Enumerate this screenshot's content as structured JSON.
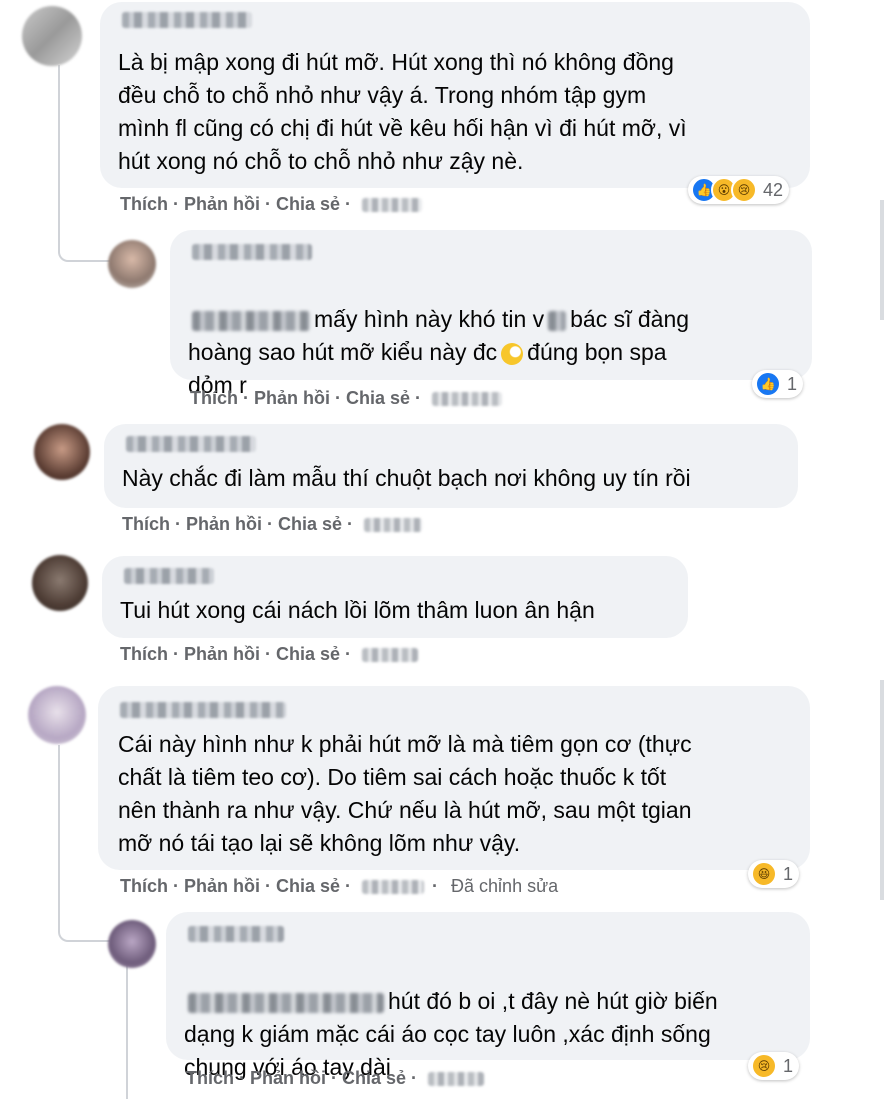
{
  "actions": {
    "like": "Thích",
    "reply": "Phản hồi",
    "share": "Chia sẻ",
    "sep": "·"
  },
  "comments": [
    {
      "text": "Là bị mập xong đi hút mỡ. Hút xong thì nó không đồng\nđều chỗ to chỗ nhỏ như vậy á. Trong nhóm tập gym\nmình fl cũng có chị đi hút về kêu hối hận vì đi hút mỡ, vì\nhút xong nó chỗ to chỗ nhỏ như zậy nè.",
      "reactions": {
        "icons": [
          "like-icon",
          "wow-icon",
          "sad-icon"
        ],
        "count": "42"
      }
    },
    {
      "text_a": "mấy hình này khó tin v",
      "text_b": "bác sĩ đàng",
      "text_c": "hoàng sao hút mỡ kiểu này đc",
      "text_d": "đúng bọn spa\ndỏm r",
      "reactions": {
        "icons": [
          "like-icon"
        ],
        "count": "1"
      }
    },
    {
      "text": "Này chắc đi làm mẫu thí chuột bạch nơi không uy tín rồi"
    },
    {
      "text": "Tui hút xong cái nách lồi lõm thâm luon ân hận"
    },
    {
      "text": "Cái này hình như k phải hút mỡ là mà tiêm gọn cơ (thực\nchất là tiêm teo cơ). Do tiêm sai cách hoặc thuốc k tốt\nnên thành ra như vậy. Chứ nếu là hút mỡ, sau một tgian\nmỡ nó tái tạo lại sẽ không lõm như vậy.",
      "edited": "Đã chỉnh sửa",
      "reactions": {
        "icons": [
          "haha-icon"
        ],
        "count": "1"
      }
    },
    {
      "text_a": "hút đó b oi ,t đây nè hút giờ biến",
      "text_b": "dạng k giám mặc cái áo cọc tay luôn ,xác định sống\nchung với áo tay dài",
      "reactions": {
        "icons": [
          "sad-icon"
        ],
        "count": "1"
      }
    }
  ],
  "colors": {
    "bubble": "#f0f2f5",
    "meta": "#65676b",
    "like": "#1877f2",
    "emoji": "#f7b928"
  }
}
